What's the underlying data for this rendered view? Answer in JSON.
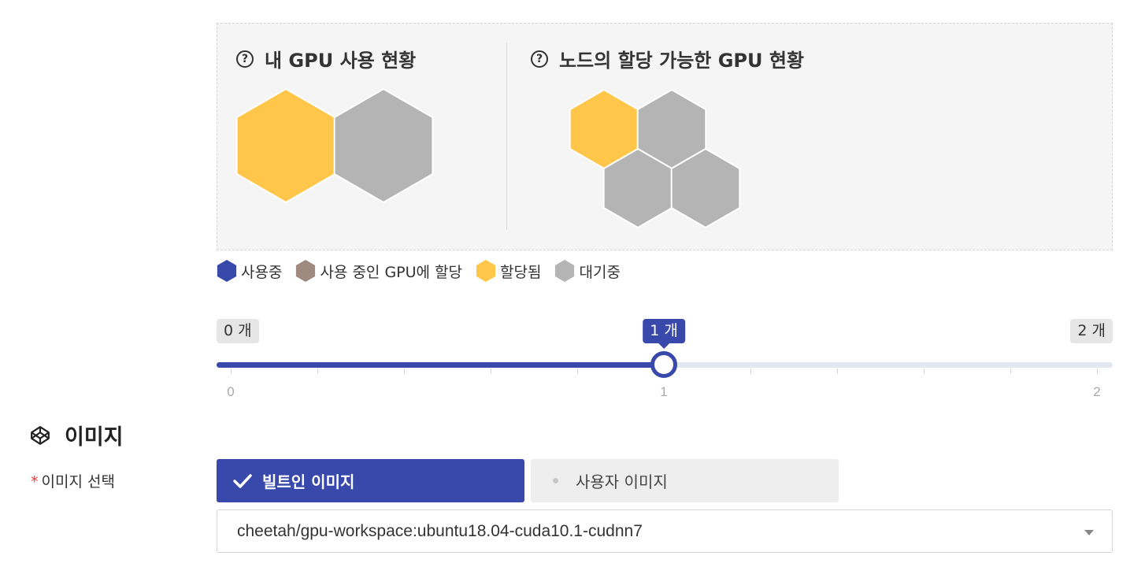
{
  "gpu_panel": {
    "my_usage_title": "내 GPU 사용 현황",
    "node_title": "노드의 할당 가능한 GPU 현황",
    "my_hexes": [
      "allocated",
      "idle"
    ],
    "node_hexes": [
      "allocated",
      "idle",
      "idle",
      "idle"
    ]
  },
  "legend": [
    {
      "label": "사용중",
      "color": "#3949ab"
    },
    {
      "label": "사용 중인 GPU에 할당",
      "color": "#9e8a7e"
    },
    {
      "label": "할당됨",
      "color": "#ffc64a"
    },
    {
      "label": "대기중",
      "color": "#b4b4b4"
    }
  ],
  "colors": {
    "accent": "#3949ab",
    "allocated": "#ffc64a",
    "idle": "#b4b4b4",
    "required": "#e53935"
  },
  "slider": {
    "min_label": "0 개",
    "max_label": "2 개",
    "value_label": "1 개",
    "min": 0,
    "max": 2,
    "value": 1,
    "marks": [
      "0",
      "1",
      "2"
    ]
  },
  "image_section": {
    "header": "이미지",
    "header_icon": "codepen-cube-icon",
    "field_label": "이미지 선택",
    "required_mark": "*",
    "builtin_label": "빌트인 이미지",
    "custom_label": "사용자 이미지",
    "selected_image": "cheetah/gpu-workspace:ubuntu18.04-cuda10.1-cudnn7"
  }
}
